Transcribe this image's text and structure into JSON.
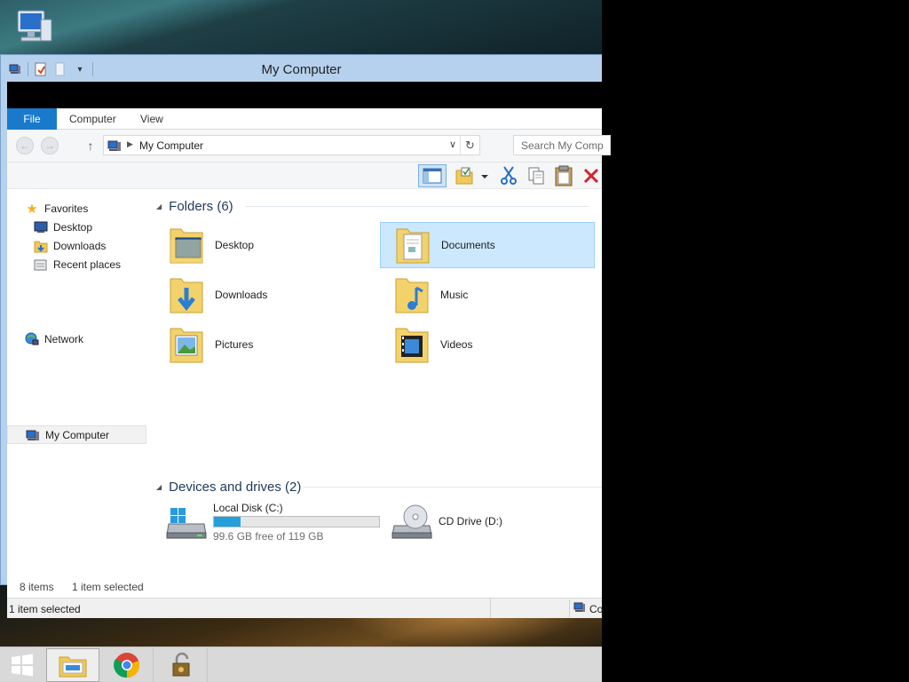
{
  "window": {
    "title": "My Computer"
  },
  "ribbon": {
    "tabs": [
      "File",
      "Computer",
      "View"
    ]
  },
  "address": {
    "path": "My Computer",
    "search_placeholder": "Search My Comp"
  },
  "nav": {
    "favorites": "Favorites",
    "desktop": "Desktop",
    "downloads": "Downloads",
    "recent": "Recent places",
    "mycomputer": "My Computer",
    "network": "Network"
  },
  "content": {
    "folders_header": "Folders (6)",
    "devices_header": "Devices and drives (2)",
    "folders": [
      {
        "name": "Desktop",
        "icon": "desktop-folder-icon"
      },
      {
        "name": "Documents",
        "icon": "documents-folder-icon",
        "selected": true
      },
      {
        "name": "Downloads",
        "icon": "downloads-folder-icon"
      },
      {
        "name": "Music",
        "icon": "music-folder-icon"
      },
      {
        "name": "Pictures",
        "icon": "pictures-folder-icon"
      },
      {
        "name": "Videos",
        "icon": "videos-folder-icon"
      }
    ],
    "drives": [
      {
        "name": "Local Disk (C:)",
        "free": "99.6 GB free of 119 GB",
        "used_fraction": 0.16,
        "icon": "hard-disk-icon"
      },
      {
        "name": "CD Drive (D:)",
        "icon": "cd-drive-icon"
      }
    ]
  },
  "status": {
    "count": "8 items",
    "selected": "1 item selected",
    "outer_selected": "1 item selected",
    "outer_right": "Co"
  },
  "colors": {
    "accent": "#1979ca",
    "selection": "#cce8ff",
    "drive_fill": "#26a0da"
  }
}
